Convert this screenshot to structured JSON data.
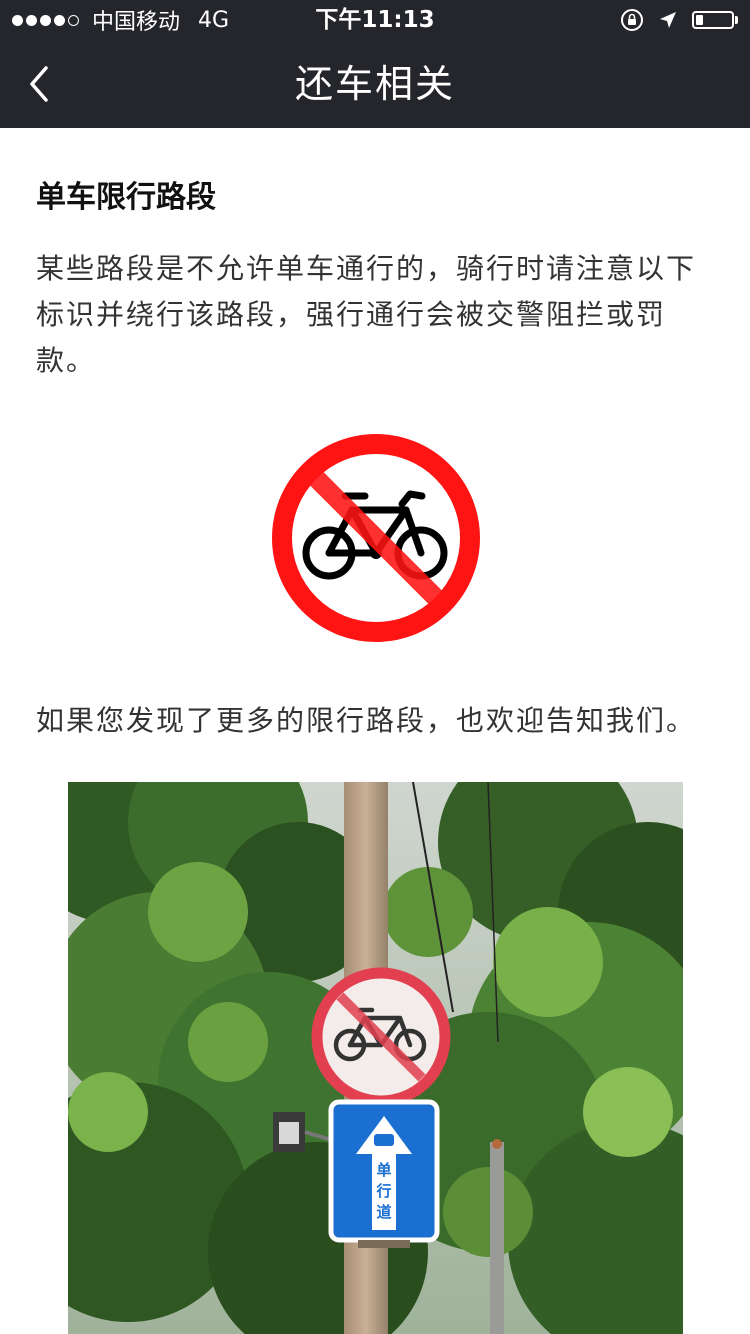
{
  "status_bar": {
    "carrier": "中国移动",
    "network": "4G",
    "time": "下午11:13",
    "battery_level": 0.2,
    "icons": [
      "signal-dots",
      "orientation-lock-icon",
      "location-arrow-icon",
      "battery-icon"
    ]
  },
  "nav": {
    "back_icon": "chevron-left-icon",
    "title": "还车相关"
  },
  "content": {
    "section_title": "单车限行路段",
    "paragraph_1": "某些路段是不允许单车通行的，骑行时请注意以下标识并绕行该路段，强行通行会被交警阻拦或罚款。",
    "paragraph_2": "如果您发现了更多的限行路段，也欢迎告知我们。",
    "sign_image": "no-bicycles-sign",
    "photo": {
      "subject": "street-signs-photo",
      "one_way_sign_text": "单行道"
    }
  },
  "colors": {
    "bar_background": "#24262b",
    "sign_red": "#ff1414",
    "one_way_blue": "#1b6fd1"
  }
}
